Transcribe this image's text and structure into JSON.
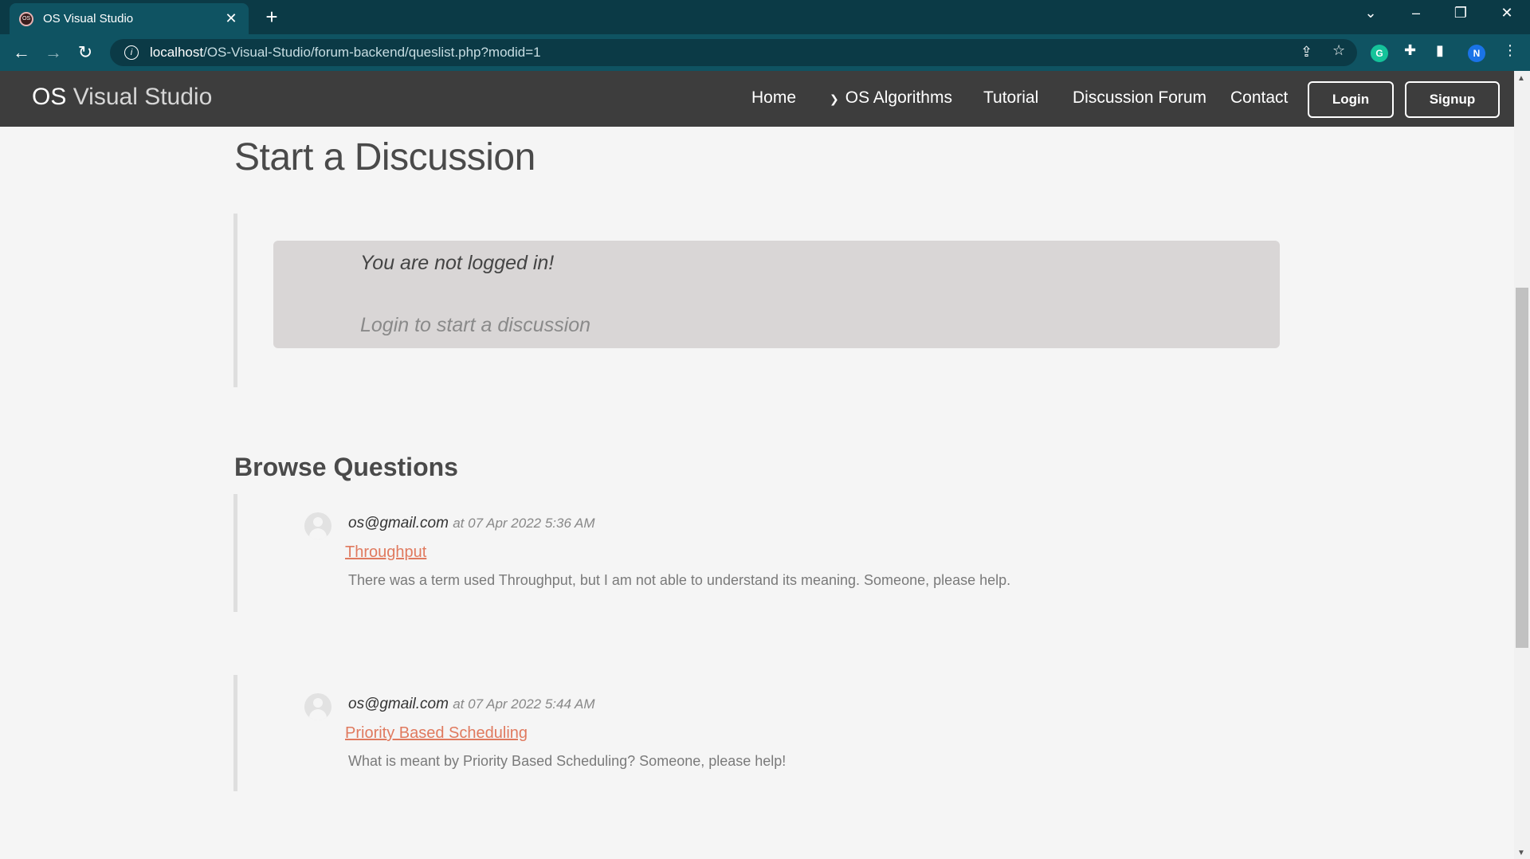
{
  "browser": {
    "tab_title": "OS Visual Studio",
    "favicon_text": "OS",
    "tab_close": "✕",
    "new_tab": "+",
    "url_host": "localhost",
    "url_path": "/OS-Visual-Studio/forum-backend/queslist.php?modid=1",
    "profile_initial": "N",
    "extension_initial": "G"
  },
  "site": {
    "brand_bold": "OS",
    "brand_rest": " Visual Studio",
    "nav": {
      "home": "Home",
      "os_algorithms": "OS Algorithms",
      "tutorial": "Tutorial",
      "discussion_forum": "Discussion Forum",
      "contact": "Contact",
      "login": "Login",
      "signup": "Signup"
    }
  },
  "main": {
    "title": "Start a Discussion",
    "notice": {
      "title": "You are not logged in!",
      "subtitle": "Login to start a discussion"
    },
    "browse_title": "Browse Questions",
    "questions": [
      {
        "email": "os@gmail.com",
        "timestamp": "at 07 Apr 2022 5:36 AM",
        "title": "Throughput",
        "description": "There was a term used Throughput, but I am not able to understand its meaning. Someone, please help."
      },
      {
        "email": "os@gmail.com",
        "timestamp": "at 07 Apr 2022 5:44 AM",
        "title": "Priority Based Scheduling",
        "description": "What is meant by Priority Based Scheduling? Someone, please help!"
      }
    ]
  },
  "colors": {
    "navbar": "#3d3d3d",
    "chrome_tabbar": "#0b3a46",
    "chrome_toolbar": "#0f5362",
    "link": "#e07a5f",
    "notice_bg": "#d9d6d6"
  }
}
